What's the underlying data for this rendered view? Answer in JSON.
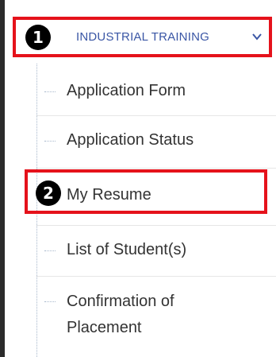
{
  "menu": {
    "header": {
      "badge": "1",
      "label": "INDUSTRIAL TRAINING",
      "chevron_icon": "chevron-down-icon"
    },
    "items": [
      {
        "label": "Application Form"
      },
      {
        "label": "Application Status"
      },
      {
        "label": "My Resume",
        "badge": "2"
      },
      {
        "label": "List of Student(s)"
      },
      {
        "label": "Confirmation of Placement"
      }
    ]
  },
  "colors": {
    "highlight": "#e5121b",
    "header_text": "#3a56a5",
    "item_text": "#333333"
  }
}
